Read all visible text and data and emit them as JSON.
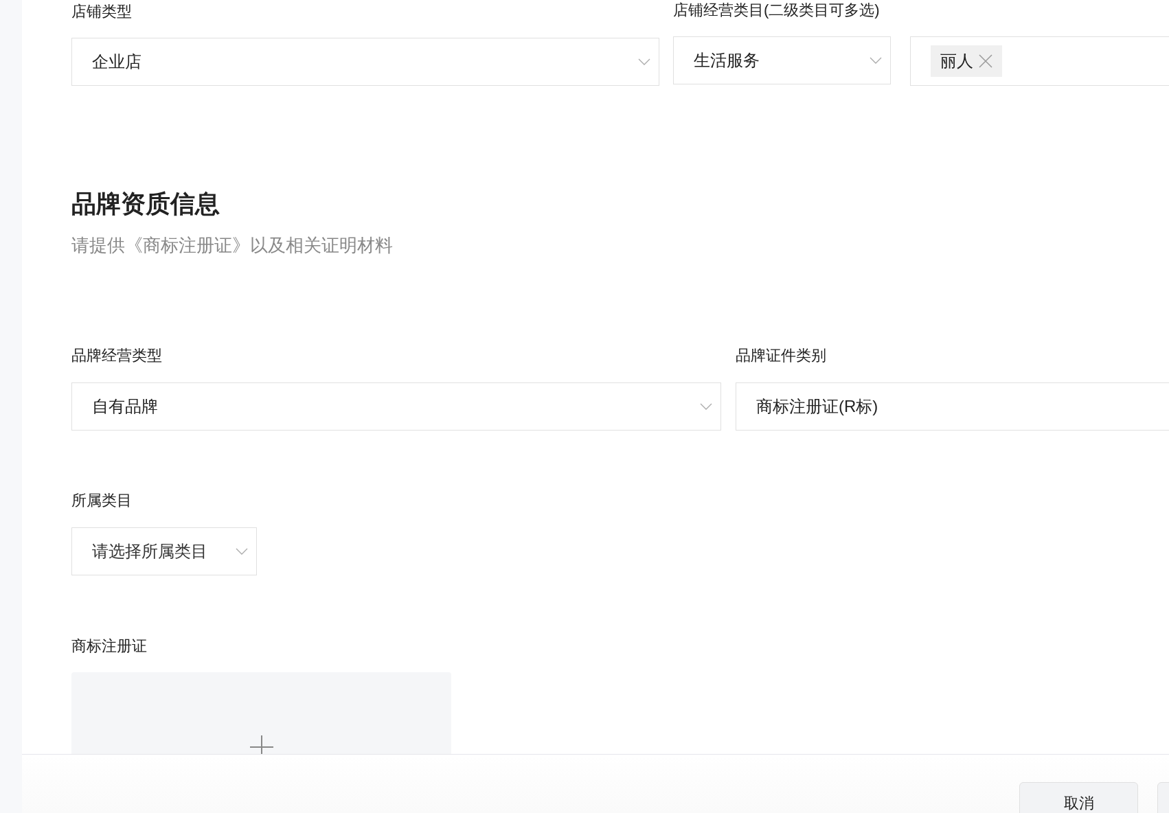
{
  "shop": {
    "fields": [
      {
        "label": "店铺类型",
        "value": "企业店",
        "has_arrow": true
      },
      {
        "label": "店铺经营类目(二级类目可多选)",
        "value": "生活服务",
        "has_arrow": true,
        "tags": [
          {
            "label": "丽人"
          }
        ]
      }
    ]
  },
  "brand_section": {
    "title": "品牌资质信息",
    "subtitle": "请提供《商标注册证》以及相关证明材料",
    "fields": [
      {
        "label": "品牌经营类型",
        "value": "自有品牌",
        "has_arrow": true
      },
      {
        "label": "品牌证件类别",
        "value": "商标注册证(R标)"
      }
    ],
    "category": {
      "label": "所属类目",
      "placeholder": "请选择所属类目"
    },
    "upload": {
      "label": "商标注册证"
    }
  },
  "footer": {
    "buttons": [
      "取消"
    ]
  }
}
